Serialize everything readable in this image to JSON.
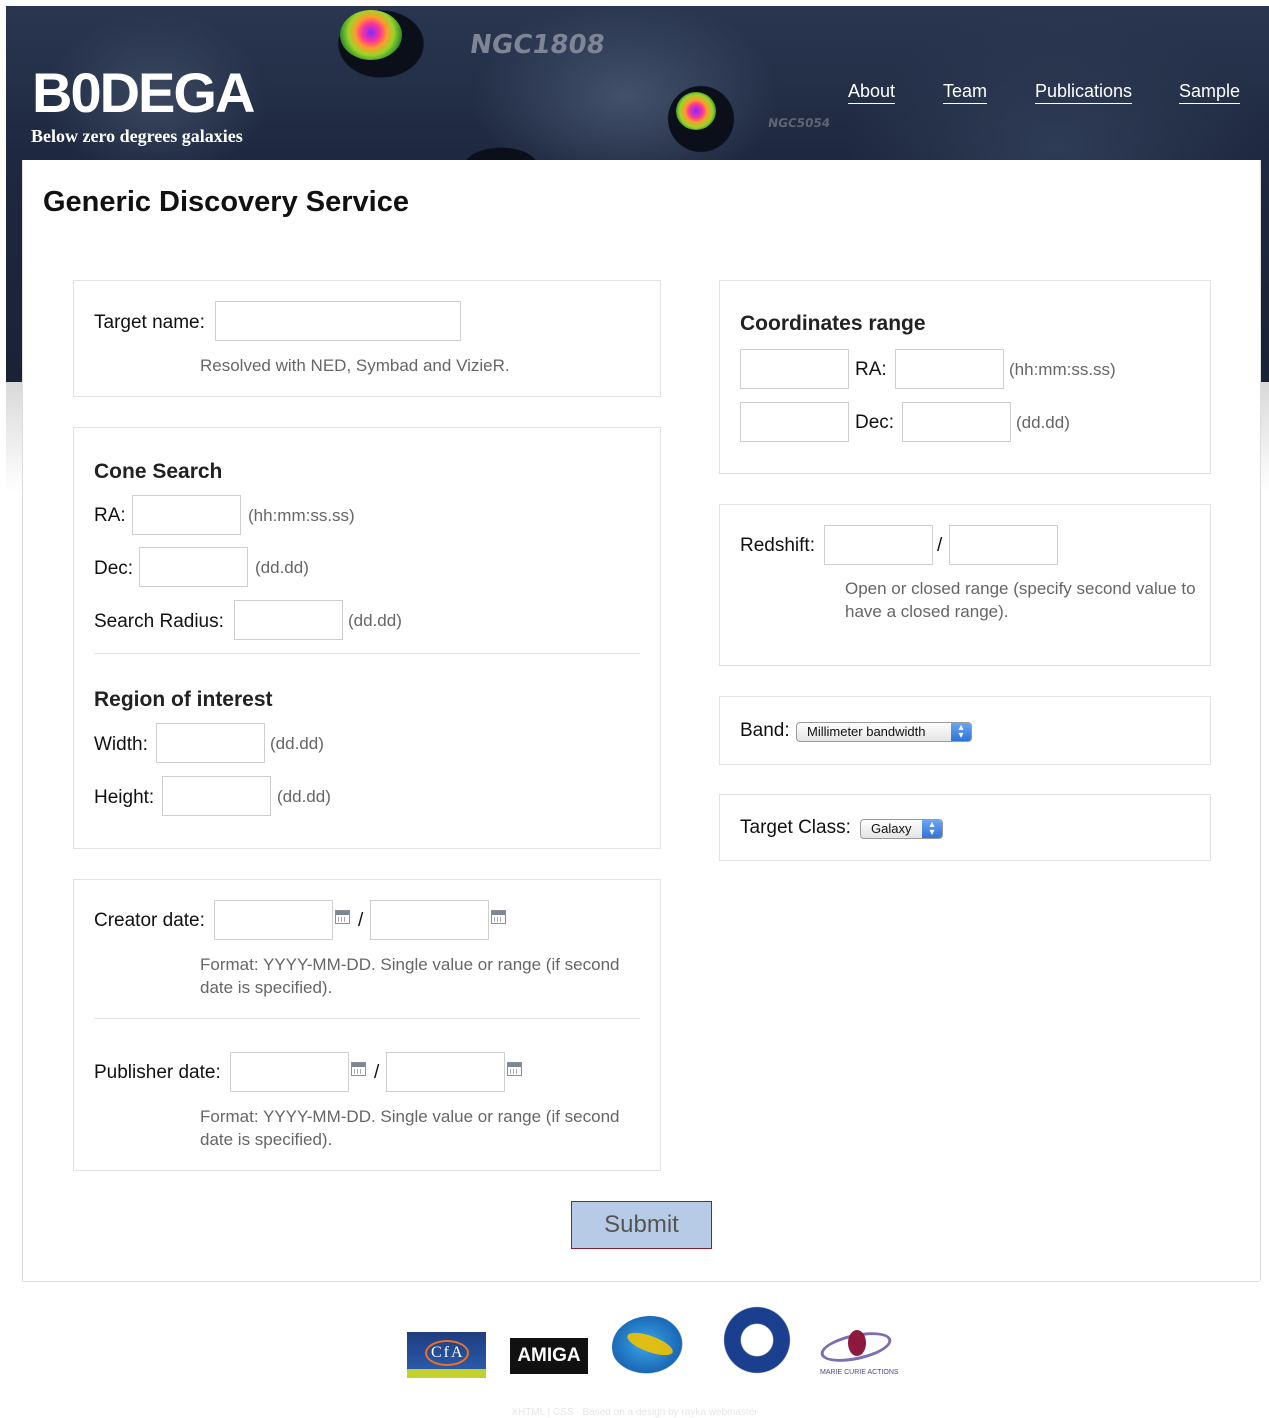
{
  "header": {
    "logo_title": "B0DEGA",
    "logo_subtitle": "Below zero degrees galaxies",
    "banner_labels": [
      "NGC1808",
      "NGC5054"
    ],
    "nav": [
      "About",
      "Team",
      "Publications",
      "Sample"
    ]
  },
  "page_title": "Generic Discovery Service",
  "target": {
    "label": "Target name:",
    "value": "",
    "hint": "Resolved with NED, Symbad and VizieR."
  },
  "cone_search": {
    "heading": "Cone Search",
    "ra_label": "RA:",
    "ra_hint": "(hh:mm:ss.ss)",
    "dec_label": "Dec:",
    "dec_hint": "(dd.dd)",
    "radius_label": "Search Radius:",
    "radius_hint": "(dd.dd)"
  },
  "region": {
    "heading": "Region of interest",
    "width_label": "Width:",
    "width_hint": "(dd.dd)",
    "height_label": "Height:",
    "height_hint": "(dd.dd)"
  },
  "dates": {
    "creator_label": "Creator date:",
    "publisher_label": "Publisher date:",
    "separator": "/",
    "hint": "Format: YYYY-MM-DD. Single value or range (if second date is specified)."
  },
  "coords_range": {
    "heading": "Coordinates range",
    "ra_label": "RA:",
    "ra_hint": "(hh:mm:ss.ss)",
    "dec_label": "Dec:",
    "dec_hint": "(dd.dd)"
  },
  "redshift": {
    "label": "Redshift:",
    "separator": "/",
    "hint": "Open or closed range (specify second value to have a closed range)."
  },
  "band": {
    "label": "Band:",
    "selected": "Millimeter bandwidth"
  },
  "target_class": {
    "label": "Target Class:",
    "selected": "Galaxy"
  },
  "submit_label": "Submit",
  "footer": {
    "logos": [
      "CfA",
      "AMIGA",
      "IAA",
      "Academia Sinica",
      "MARIE CURIE ACTIONS"
    ],
    "cfa_text": "CfA",
    "amiga_text": "AMIGA",
    "mca_text": "MARIE CURIE ACTIONS",
    "credit": "XHTML | CSS · Based on a design by rayka webmaster"
  },
  "colors": {
    "banner": "#1e2840",
    "submit_bg": "#b8cbe6",
    "submit_border": "#8a1f2f",
    "link": "#ffffff"
  }
}
